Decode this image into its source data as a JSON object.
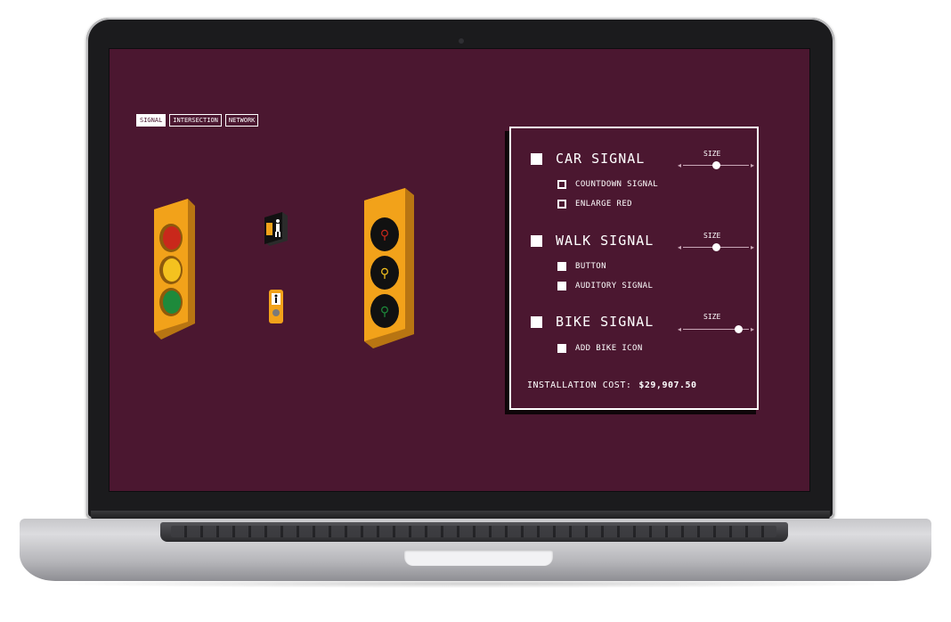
{
  "tabs": [
    {
      "label": "SIGNAL",
      "active": true
    },
    {
      "label": "INTERSECTION",
      "active": false
    },
    {
      "label": "NETWORK",
      "active": false
    }
  ],
  "panel": {
    "car": {
      "label": "CAR SIGNAL",
      "checked": true,
      "size_label": "SIZE",
      "size": 0.5,
      "options": [
        {
          "label": "COUNTDOWN SIGNAL",
          "checked": false
        },
        {
          "label": "ENLARGE RED",
          "checked": false
        }
      ]
    },
    "walk": {
      "label": "WALK SIGNAL",
      "checked": true,
      "size_label": "SIZE",
      "size": 0.5,
      "options": [
        {
          "label": "BUTTON",
          "checked": true
        },
        {
          "label": "AUDITORY SIGNAL",
          "checked": true
        }
      ]
    },
    "bike": {
      "label": "BIKE SIGNAL",
      "checked": true,
      "size_label": "SIZE",
      "size": 0.8,
      "options": [
        {
          "label": "ADD BIKE ICON",
          "checked": true
        }
      ]
    },
    "cost_label": "INSTALLATION COST:",
    "cost_value": "$29,907.50"
  },
  "colors": {
    "background": "#4b1730",
    "signal_body": "#f2a21a",
    "red_lamp": "#c9281b",
    "yellow_lamp": "#f4c21f",
    "green_lamp": "#1e8a3b",
    "bike_green": "#1e8a3b"
  },
  "icons": [
    "traffic-light",
    "bike-traffic-light",
    "walk-hand-sign",
    "push-button-walk-sign"
  ]
}
